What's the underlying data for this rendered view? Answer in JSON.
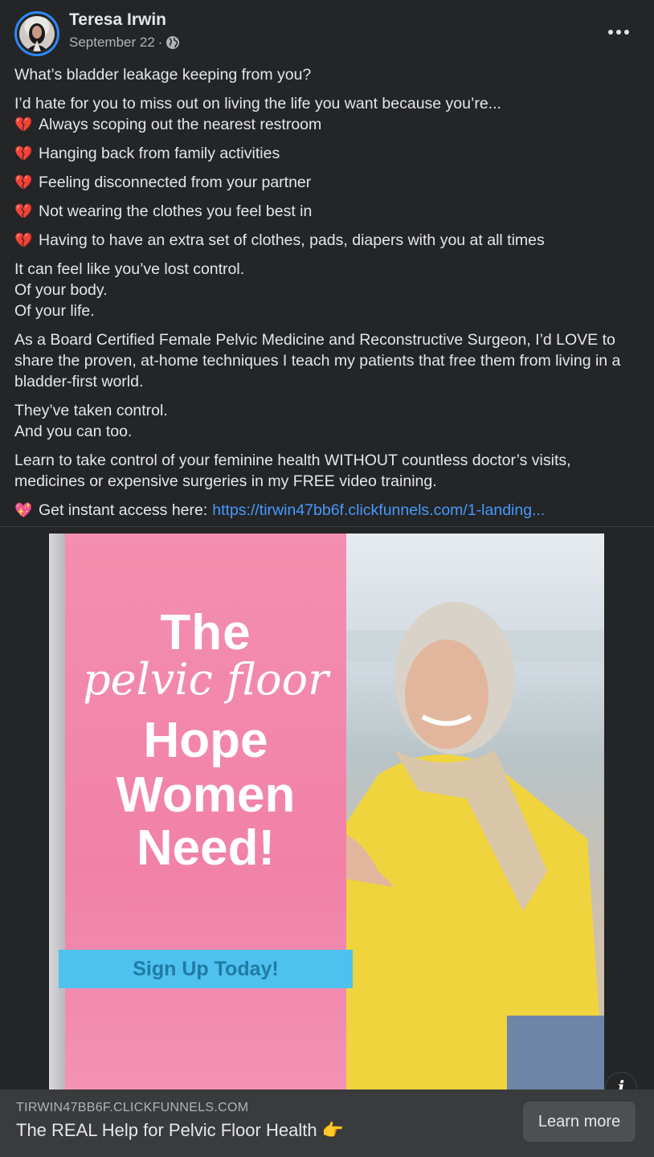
{
  "post": {
    "author": "Teresa Irwin",
    "date": "September 22",
    "separator": "·",
    "lines": {
      "l1": "What’s bladder leakage keeping from you?",
      "l2": "I’d hate for you to miss out on living the life you want because you’re...",
      "b1": "Always scoping out the nearest restroom",
      "b2": "Hanging back from family activities",
      "b3": "Feeling disconnected from your partner",
      "b4": "Not wearing the clothes you feel best in",
      "b5": "Having to have an extra set of clothes, pads, diapers with you at all times",
      "l3a": "It can feel like you’ve lost control.",
      "l3b": "Of your body.",
      "l3c": "Of your life.",
      "l4": "As a Board Certified Female Pelvic Medicine and Reconstructive Surgeon, I’d LOVE to share the proven, at-home techniques I teach my patients that free them from living in a bladder-first world.",
      "l5a": "They’ve taken control.",
      "l5b": "And you can too.",
      "l6": "Learn to take control of your feminine health WITHOUT countless doctor’s visits, medicines or expensive surgeries in my FREE video training.",
      "l7": "Get instant access here:",
      "link": "https://tirwin47bb6f.clickfunnels.com/1-landing..."
    },
    "bullet_emoji": "💔",
    "access_emoji": "💖"
  },
  "ad_image": {
    "line1": "The",
    "line2": "pelvic floor",
    "line3": "Hope",
    "line4": "Women",
    "line5": "Need!",
    "cta": "Sign Up Today!"
  },
  "footer": {
    "domain": "TIRWIN47BB6F.CLICKFUNNELS.COM",
    "headline": "The REAL Help for Pelvic Floor Health",
    "headline_emoji": "👉",
    "button": "Learn more"
  },
  "icons": {
    "info": "i",
    "globe": "globe-icon",
    "more": "more-options-icon"
  }
}
